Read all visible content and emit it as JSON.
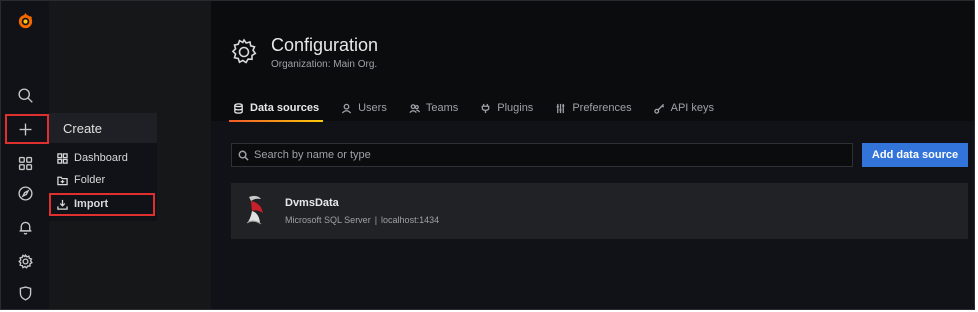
{
  "header": {
    "title": "Configuration",
    "subtitle": "Organization: Main Org."
  },
  "tabs": [
    {
      "label": "Data sources",
      "icon": "database-icon",
      "active": true
    },
    {
      "label": "Users",
      "icon": "user-icon",
      "active": false
    },
    {
      "label": "Teams",
      "icon": "users-icon",
      "active": false
    },
    {
      "label": "Plugins",
      "icon": "plug-icon",
      "active": false
    },
    {
      "label": "Preferences",
      "icon": "sliders-icon",
      "active": false
    },
    {
      "label": "API keys",
      "icon": "key-icon",
      "active": false
    }
  ],
  "search": {
    "placeholder": "Search by name or type",
    "value": ""
  },
  "add_button_label": "Add data source",
  "datasources": [
    {
      "name": "DvmsData",
      "type": "Microsoft SQL Server",
      "separator": "|",
      "host": "localhost:1434"
    }
  ],
  "create_menu": {
    "header": "Create",
    "items": [
      {
        "label": "Dashboard",
        "icon": "apps-icon"
      },
      {
        "label": "Folder",
        "icon": "folder-icon"
      },
      {
        "label": "Import",
        "icon": "import-icon"
      }
    ]
  },
  "sidebar": {
    "icons": [
      "grafana-logo",
      "search-icon",
      "plus-icon",
      "apps-icon",
      "compass-icon",
      "bell-icon",
      "gear-icon",
      "shield-icon"
    ]
  },
  "colors": {
    "accent_blue": "#3274d9",
    "highlight_red": "#e02f2f",
    "tab_underline_start": "#f05a28",
    "tab_underline_end": "#fbca0a",
    "logo_orange": "#f46800"
  }
}
